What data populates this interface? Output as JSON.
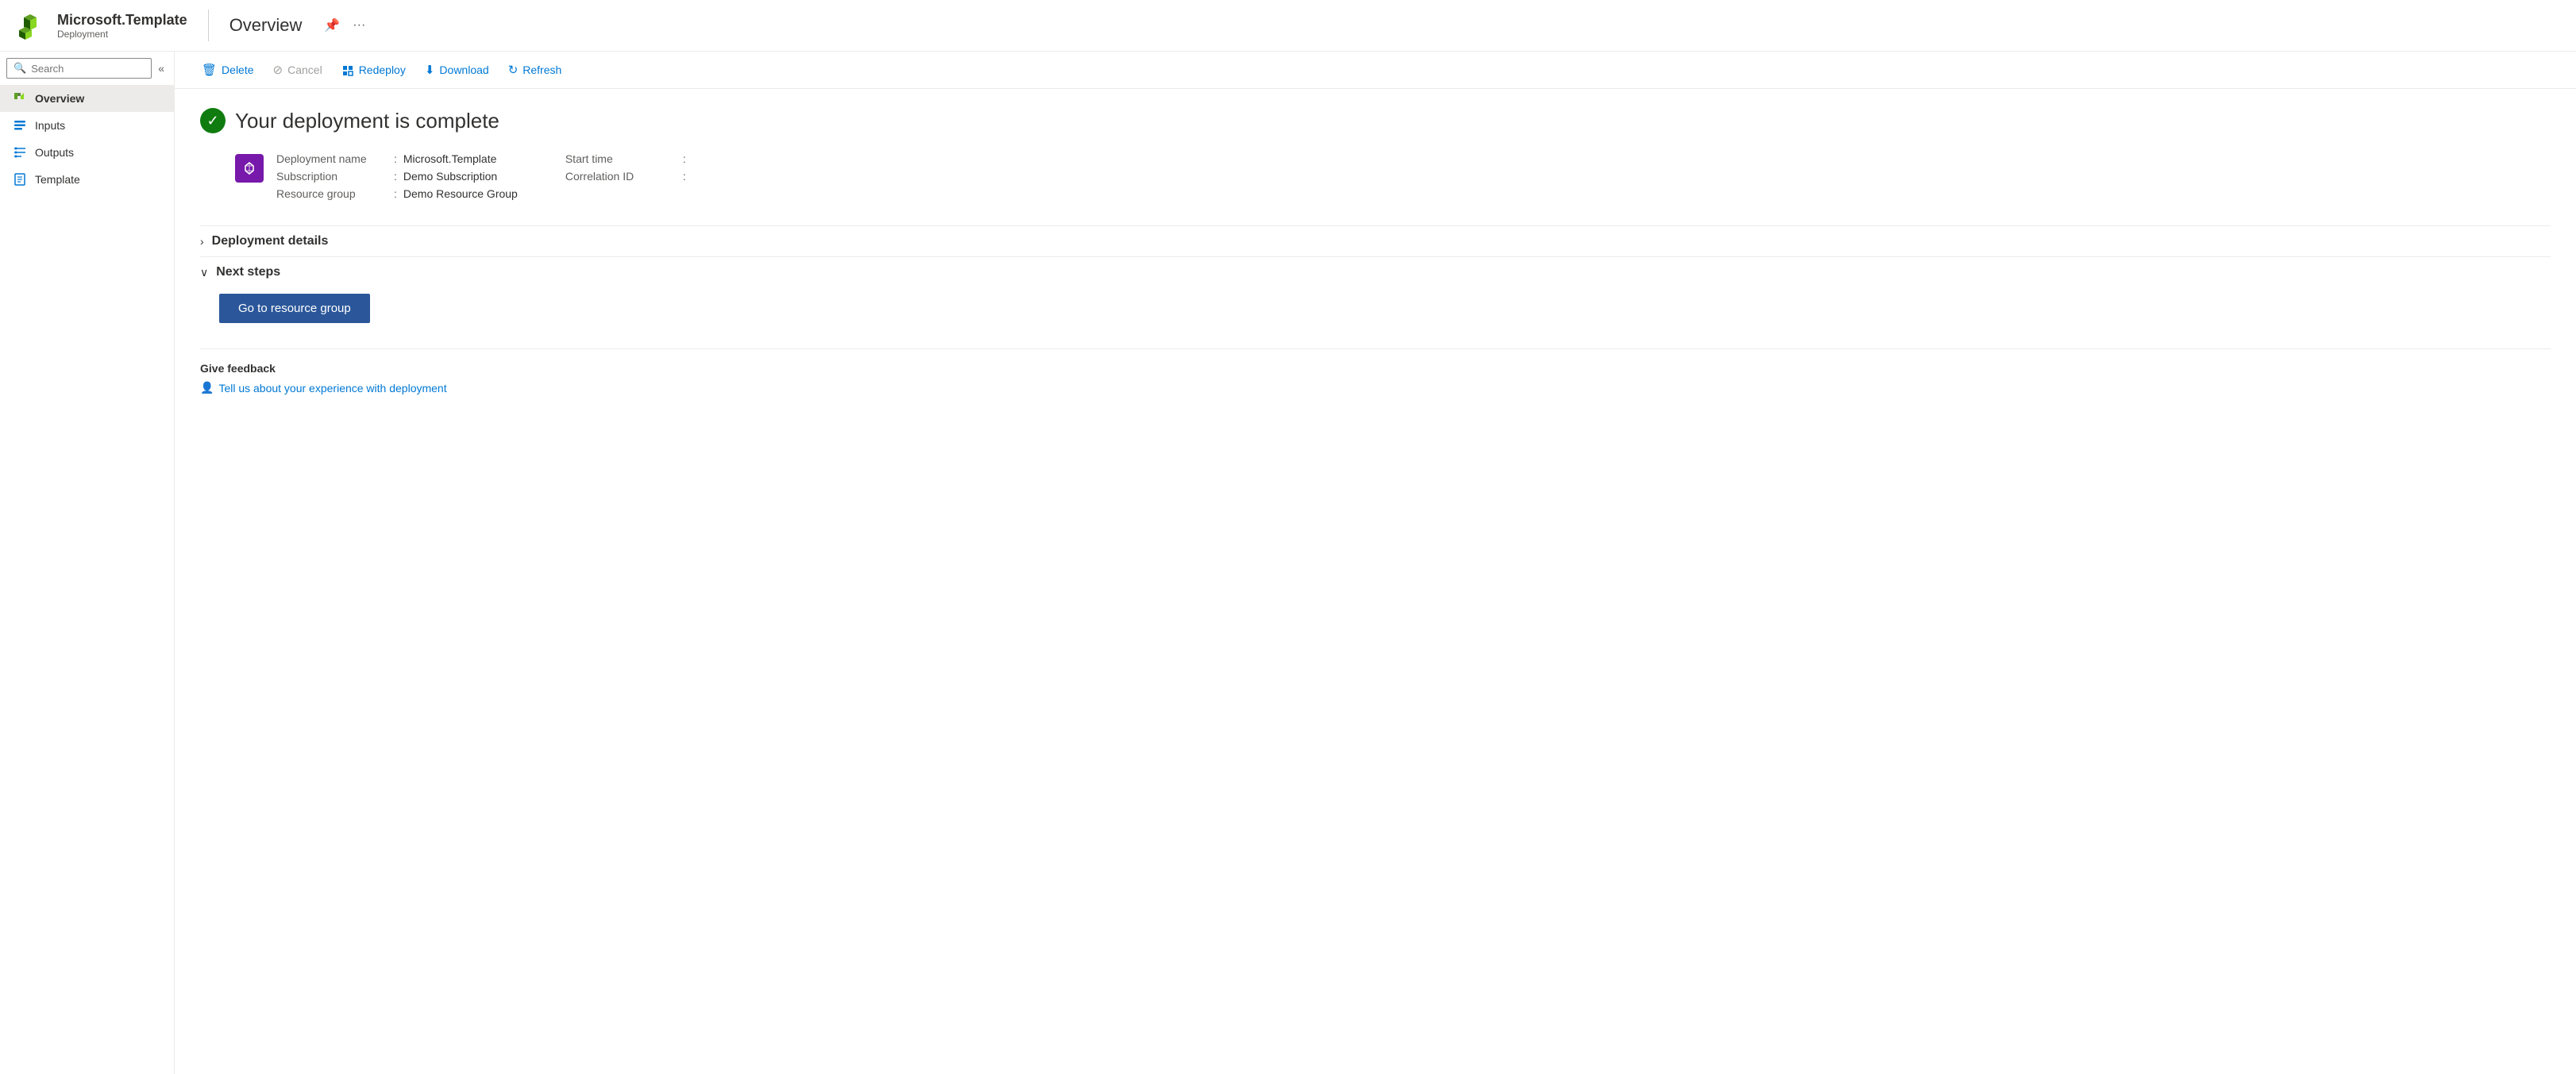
{
  "header": {
    "app_name": "Microsoft.Template",
    "app_subtitle": "Deployment",
    "divider": "|",
    "page_title": "Overview",
    "pin_icon": "📌",
    "more_icon": "···"
  },
  "sidebar": {
    "search_placeholder": "Search",
    "collapse_icon": "«",
    "nav_items": [
      {
        "id": "overview",
        "label": "Overview",
        "active": true
      },
      {
        "id": "inputs",
        "label": "Inputs",
        "active": false
      },
      {
        "id": "outputs",
        "label": "Outputs",
        "active": false
      },
      {
        "id": "template",
        "label": "Template",
        "active": false
      }
    ]
  },
  "toolbar": {
    "delete_label": "Delete",
    "cancel_label": "Cancel",
    "redeploy_label": "Redeploy",
    "download_label": "Download",
    "refresh_label": "Refresh"
  },
  "content": {
    "status_message": "Your deployment is complete",
    "deployment_name_label": "Deployment name",
    "deployment_name_value": "Microsoft.Template",
    "subscription_label": "Subscription",
    "subscription_value": "Demo Subscription",
    "resource_group_label": "Resource group",
    "resource_group_value": "Demo Resource Group",
    "start_time_label": "Start time",
    "start_time_value": "",
    "correlation_id_label": "Correlation ID",
    "correlation_id_value": "",
    "deployment_details_label": "Deployment details",
    "next_steps_label": "Next steps",
    "go_to_resource_group_label": "Go to resource group",
    "feedback_title": "Give feedback",
    "feedback_link_label": "Tell us about your experience with deployment"
  }
}
